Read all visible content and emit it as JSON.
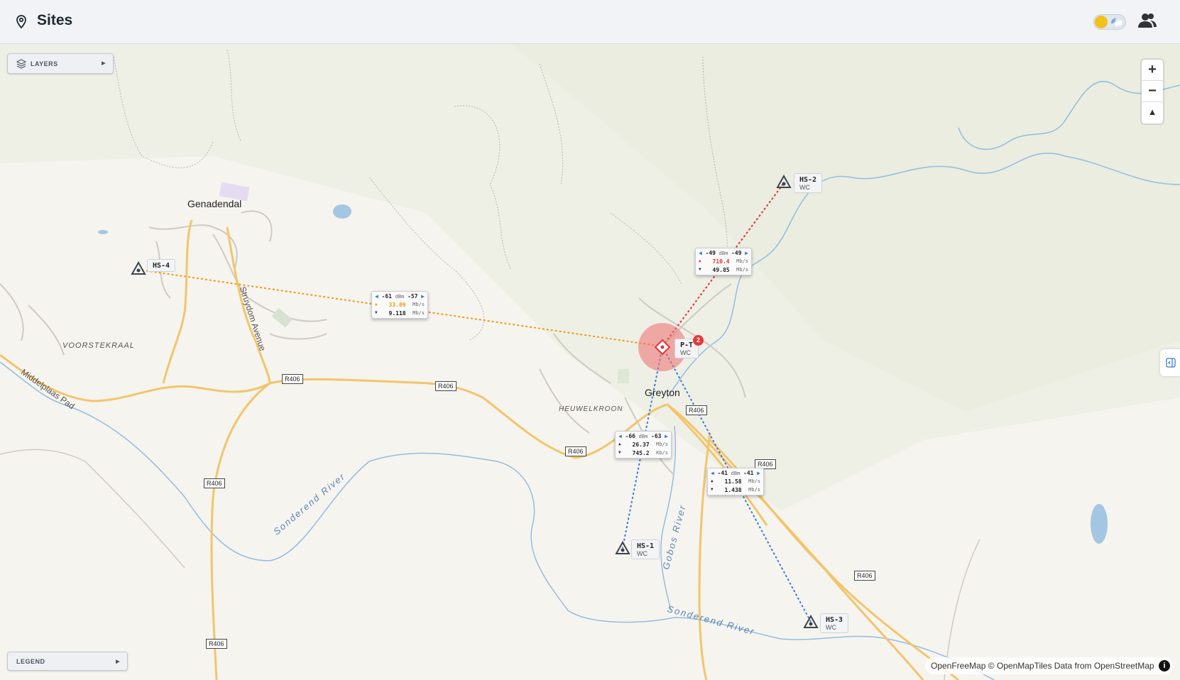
{
  "header": {
    "title": "Sites",
    "pin_icon": "map-pin-icon",
    "theme_toggle_icon": "sun-moon-toggle-icon",
    "users_icon": "users-icon"
  },
  "controls": {
    "layers_label": "LAYERS",
    "legend_label": "LEGEND",
    "zoom_in": "+",
    "zoom_out": "−",
    "compass": "▲"
  },
  "attribution": "OpenFreeMap © OpenMapTiles Data from OpenStreetMap",
  "attribution_info": "i",
  "hub": {
    "name": "P-T",
    "region": "WC",
    "badge": "2"
  },
  "sites": [
    {
      "name": "HS-2",
      "region": "WC"
    },
    {
      "name": "HS-4",
      "region": ""
    },
    {
      "name": "HS-1",
      "region": "WC"
    },
    {
      "name": "HS-3",
      "region": "WC"
    }
  ],
  "links": [
    {
      "target": "HS-2",
      "rx_left": "-49",
      "unit": "dBm",
      "rx_right": "-49",
      "up": "710.4",
      "up_unit": "Mb/s",
      "down": "49.85",
      "down_unit": "Mb/s",
      "color": "#e0333a"
    },
    {
      "target": "HS-4",
      "rx_left": "-61",
      "unit": "dBm",
      "rx_right": "-57",
      "up": "33.09",
      "up_unit": "Mb/s",
      "down": "9.118",
      "down_unit": "Mb/s",
      "color": "#f09a12"
    },
    {
      "target": "HS-1",
      "rx_left": "-66",
      "unit": "dBm",
      "rx_right": "-63",
      "up": "26.37",
      "up_unit": "Mb/s",
      "down": "745.2",
      "down_unit": "Kb/s",
      "color": "#3a7bd5"
    },
    {
      "target": "HS-3",
      "rx_left": "-41",
      "unit": "dBm",
      "rx_right": "-41",
      "up": "11.58",
      "up_unit": "Mb/s",
      "down": "1.438",
      "down_unit": "Mb/s",
      "color": "#3a7bd5"
    }
  ],
  "map_labels": {
    "towns": [
      "Genadendal",
      "Greyton"
    ],
    "suburbs": [
      "VOORSTEKRAAL",
      "HEUWELKROON"
    ],
    "streets": [
      "Middelplaas Pad",
      "Struydom Avenue"
    ],
    "rivers": [
      "Sonderend River",
      "Gobos River",
      "Sonderend River"
    ],
    "roads": [
      "R406",
      "R406",
      "R406",
      "R406",
      "R406",
      "R406",
      "R406",
      "R406"
    ]
  }
}
